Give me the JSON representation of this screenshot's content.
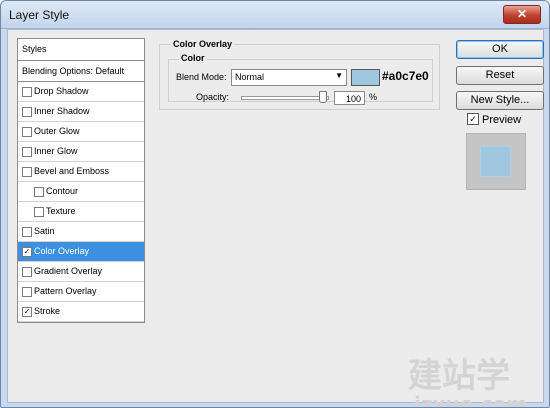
{
  "window": {
    "title": "Layer Style",
    "close_label": "✕"
  },
  "styles_panel": {
    "header": "Styles",
    "blending_options": "Blending Options: Default",
    "items": [
      {
        "label": "Drop Shadow",
        "checked": false,
        "selected": false,
        "indent": false
      },
      {
        "label": "Inner Shadow",
        "checked": false,
        "selected": false,
        "indent": false
      },
      {
        "label": "Outer Glow",
        "checked": false,
        "selected": false,
        "indent": false
      },
      {
        "label": "Inner Glow",
        "checked": false,
        "selected": false,
        "indent": false
      },
      {
        "label": "Bevel and Emboss",
        "checked": false,
        "selected": false,
        "indent": false
      },
      {
        "label": "Contour",
        "checked": false,
        "selected": false,
        "indent": true
      },
      {
        "label": "Texture",
        "checked": false,
        "selected": false,
        "indent": true
      },
      {
        "label": "Satin",
        "checked": false,
        "selected": false,
        "indent": false
      },
      {
        "label": "Color Overlay",
        "checked": true,
        "selected": true,
        "indent": false
      },
      {
        "label": "Gradient Overlay",
        "checked": false,
        "selected": false,
        "indent": false
      },
      {
        "label": "Pattern Overlay",
        "checked": false,
        "selected": false,
        "indent": false
      },
      {
        "label": "Stroke",
        "checked": true,
        "selected": false,
        "indent": false
      }
    ]
  },
  "color_overlay": {
    "title": "Color Overlay",
    "color_group": "Color",
    "blend_mode_label": "Blend Mode:",
    "blend_mode_value": "Normal",
    "color_hex": "#a0c7e0",
    "opacity_label": "Opacity:",
    "opacity_value": "100",
    "opacity_unit": "%",
    "opacity_fraction": 1.0
  },
  "buttons": {
    "ok": "OK",
    "reset": "Reset",
    "new_style": "New Style..."
  },
  "preview": {
    "label": "Preview",
    "checked": true
  },
  "watermark": {
    "logo": "建站学",
    "url": "jzxue.com"
  },
  "colors": {
    "swatch": "#a0c7e0",
    "selection": "#3d8fe0"
  }
}
